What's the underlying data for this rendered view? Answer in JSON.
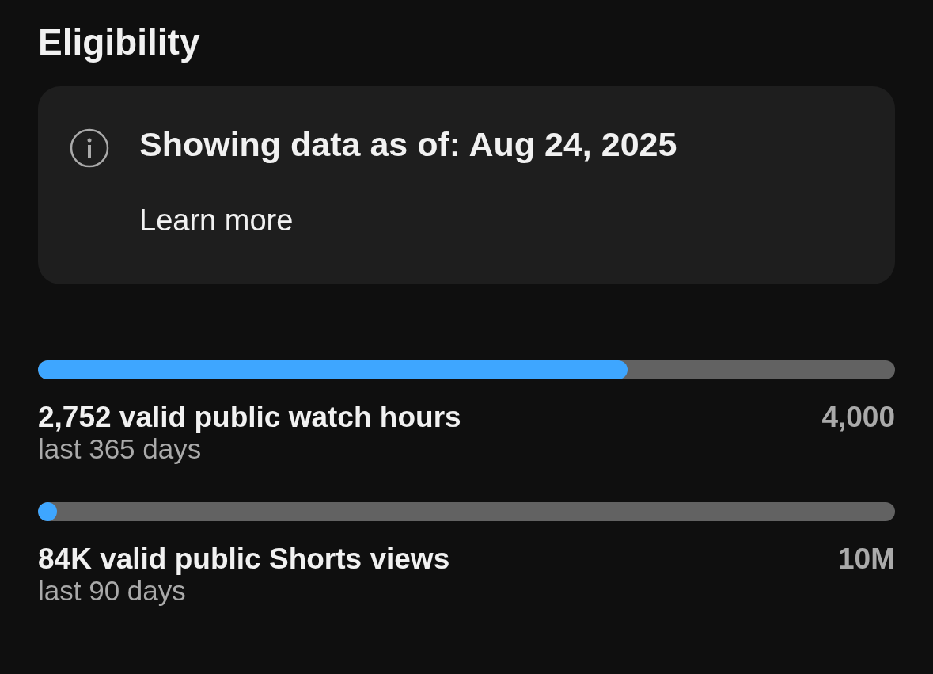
{
  "title": "Eligibility",
  "notice": {
    "text": "Showing data as of: Aug 24, 2025",
    "link": "Learn more"
  },
  "metrics": [
    {
      "label": "2,752 valid public watch hours",
      "target": "4,000",
      "period": "last 365 days",
      "level": 0.688
    },
    {
      "label": "84K valid public Shorts views",
      "target": "10M",
      "period": "last 90 days",
      "level": 0.0084
    }
  ]
}
